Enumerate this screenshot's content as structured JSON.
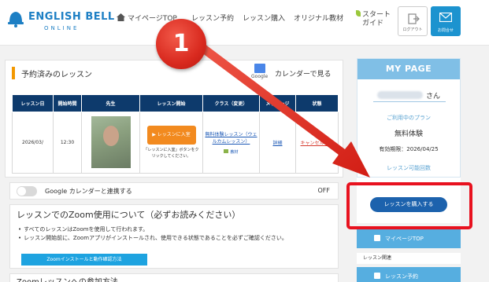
{
  "header": {
    "logo_main": "ENGLISH BELL",
    "logo_sub": "ONLINE",
    "nav_mypage": "マイページTOP",
    "nav_reserve": "レッスン予約",
    "nav_purchase": "レッスン購入",
    "nav_original": "オリジナル教材",
    "nav_start_guide_1": "スタート",
    "nav_start_guide_2": "ガイド",
    "logout_label": "ログアウト",
    "contact_label": "お問合せ"
  },
  "reserved": {
    "title": "予約済みのレッスン",
    "calendar_link": "カレンダーで見る",
    "google_badge": "Google",
    "columns": [
      "レッスン日",
      "開始時間",
      "先生",
      "レッスン開始",
      "クラス（変更）",
      "メッセージ",
      "状態"
    ],
    "row": {
      "date": "2026/03/",
      "time": "12:30",
      "start_button": "▶ レッスンに入室",
      "start_note": "「レッスンに入室」ボタンをクリックしてください。",
      "class_link": "無料体験レッスン（ウェルカムレッスン）",
      "kyozai": "教材",
      "message": "詳細",
      "status": "キャンセルする"
    }
  },
  "google_sync": {
    "label": "Google カレンダーと連携する",
    "state": "OFF"
  },
  "zoom": {
    "title": "レッスンでのZoom使用について（必ずお読みください）",
    "bullet_1": "すべてのレッスンはZoomを使用して行われます。",
    "bullet_2": "レッスン開始前に、Zoomアプリがインストールされ、使用できる状態であることを必ずご確認ください。",
    "button": "Zoomインストールと動作確認方法",
    "next_title": "Zoomレッスンへの参加方法"
  },
  "mypage": {
    "title": "MY PAGE",
    "user_suffix": "さん",
    "plan_label": "ご利用中のプラン",
    "plan_value": "無料体験",
    "expiry": "有効期限：2026/04/25",
    "remaining_label": "レッスン可能回数",
    "buy_button": "レッスンを購入する",
    "menu_mypage": "マイページTOP",
    "menu_section": "レッスン関連",
    "menu_reserve": "レッスン予約"
  },
  "annotation": {
    "marker": "1"
  },
  "colors": {
    "brand_blue": "#1d7fc4",
    "table_header": "#0d3a6c",
    "start_orange": "#f28a1f",
    "highlight_red": "#e8121f",
    "buy_button": "#1c62ad"
  }
}
